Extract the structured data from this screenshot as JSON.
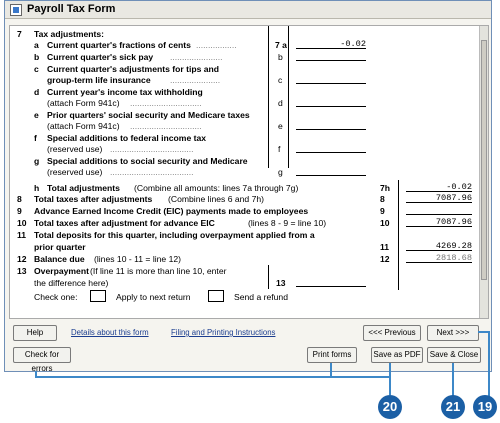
{
  "window": {
    "title": "Payroll Tax Form"
  },
  "rows": [
    {
      "num": "7",
      "letter": "",
      "text": "Tax adjustments:",
      "bold": true,
      "line": "",
      "value": ""
    },
    {
      "num": "",
      "letter": "a",
      "text": "Current quarter's fractions of cents",
      "bold": true,
      "line": "7 a",
      "value": "-0.02"
    },
    {
      "num": "",
      "letter": "b",
      "text": "Current quarter's sick pay",
      "bold": true,
      "line": "b",
      "value": ""
    },
    {
      "num": "",
      "letter": "c",
      "text": "Current quarter's adjustments for tips and",
      "bold": true,
      "line": "",
      "value": ""
    },
    {
      "num": "",
      "letter": "",
      "text": "group-term life insurance",
      "bold": true,
      "line": "c",
      "value": ""
    },
    {
      "num": "",
      "letter": "d",
      "text": "Current year's income tax withholding",
      "bold": true,
      "line": "",
      "value": ""
    },
    {
      "num": "",
      "letter": "",
      "text": "(attach Form 941c)",
      "bold": false,
      "line": "d",
      "value": ""
    },
    {
      "num": "",
      "letter": "e",
      "text": "Prior quarters' social security and Medicare taxes",
      "bold": true,
      "line": "",
      "value": ""
    },
    {
      "num": "",
      "letter": "",
      "text": "(attach Form 941c)",
      "bold": false,
      "line": "e",
      "value": ""
    },
    {
      "num": "",
      "letter": "f",
      "text": "Special additions to federal income tax",
      "bold": true,
      "line": "",
      "value": ""
    },
    {
      "num": "",
      "letter": "",
      "text": "(reserved use)",
      "bold": false,
      "line": "f",
      "value": ""
    },
    {
      "num": "",
      "letter": "g",
      "text": "Special additions to social security and Medicare",
      "bold": true,
      "line": "",
      "value": ""
    },
    {
      "num": "",
      "letter": "",
      "text": "(reserved use)",
      "bold": false,
      "line": "g",
      "value": ""
    }
  ],
  "totals": [
    {
      "num": "",
      "letter": "h",
      "text": "Total adjustments",
      "note": "(Combine all amounts: lines 7a through 7g)",
      "line": "7h",
      "value": "-0.02",
      "gray": false
    },
    {
      "num": "8",
      "letter": "",
      "text": "Total taxes after adjustments",
      "note": "(Combine lines 6 and 7h)",
      "line": "8",
      "value": "7087.96",
      "gray": false
    },
    {
      "num": "9",
      "letter": "",
      "text": "Advance Earned Income Credit (EIC) payments made to employees",
      "note": "",
      "line": "9",
      "value": "",
      "gray": false
    },
    {
      "num": "10",
      "letter": "",
      "text": "Total taxes after adjustment for advance EIC",
      "note": "(lines 8 - 9 = line 10)",
      "line": "10",
      "value": "7087.96",
      "gray": false
    },
    {
      "num": "11",
      "letter": "",
      "text": "Total deposits for this quarter, including overpayment applied from a",
      "note": "",
      "line": "",
      "value": "",
      "gray": false
    },
    {
      "num": "",
      "letter": "",
      "text": "prior quarter",
      "note": "",
      "line": "11",
      "value": "4269.28",
      "gray": false
    },
    {
      "num": "12",
      "letter": "",
      "text": "Balance due",
      "note": "(lines 10 - 11 = line 12)",
      "line": "12",
      "value": "2818.68",
      "gray": true
    }
  ],
  "overpayment": {
    "num": "13",
    "title": "Overpayment",
    "note1": "(If line 11 is more than line 10, enter",
    "note2": "the difference here)",
    "line": "13",
    "check_one": "Check one:",
    "opt1": "Apply to next return",
    "opt2": "Send a refund"
  },
  "bottom": {
    "help": "Help",
    "details_link": "Details about this form",
    "filing_link": "Filing and Printing Instructions",
    "previous": "<<<  Previous",
    "next": "Next  >>>",
    "check_errors": "Check for errors",
    "print_forms": "Print forms",
    "save_pdf": "Save as PDF",
    "save_close": "Save & Close"
  },
  "callouts": [
    "20",
    "21",
    "19"
  ],
  "colors": {
    "callout": "#1b5fa5",
    "line": "#3d88c8"
  }
}
